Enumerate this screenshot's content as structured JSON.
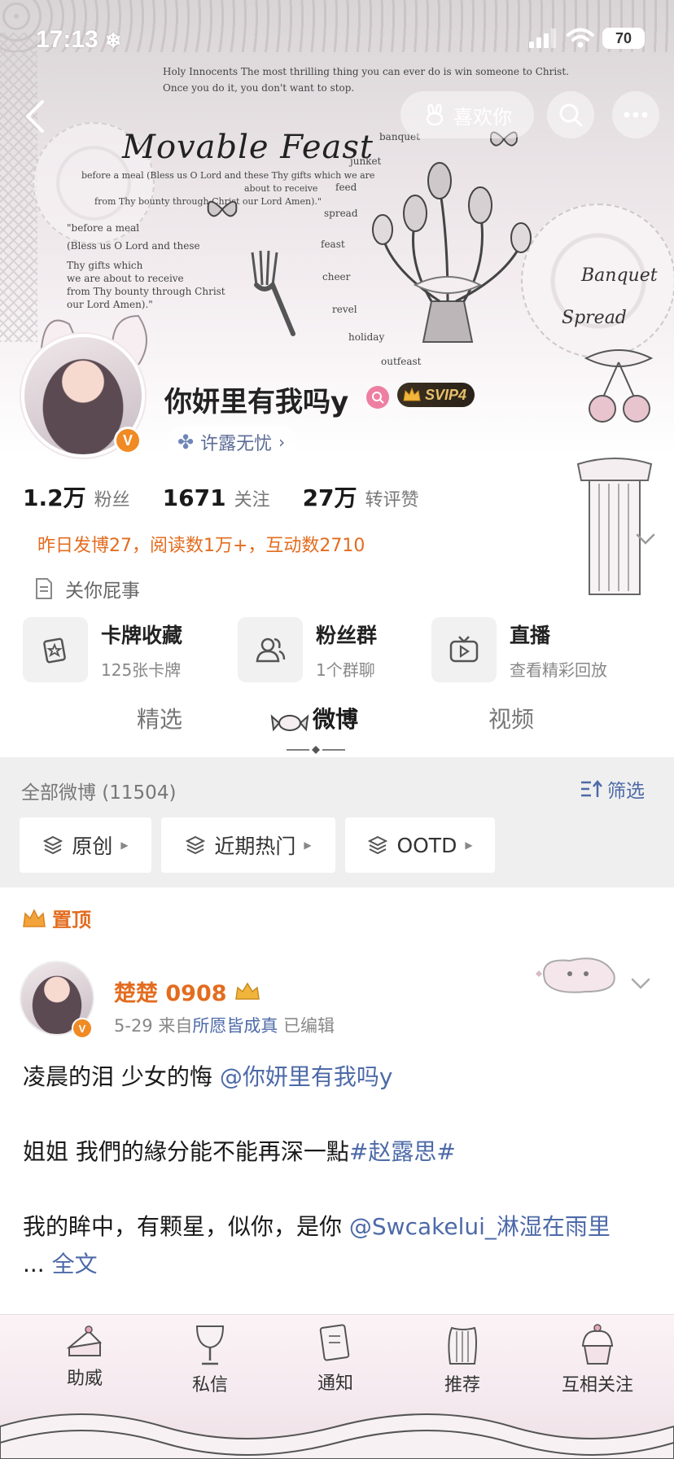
{
  "status_bar": {
    "time": "17:13",
    "battery": "70"
  },
  "banner": {
    "title": "Movable Feast",
    "top_line_1": "Holy Innocents The most thrilling thing you can ever do is win someone to Christ.",
    "top_line_2": "Once you do it, you don't want to stop.",
    "prayer_1": "before a meal (Bless us O Lord and these Thy gifts which we are",
    "prayer_2": "about to receive",
    "prayer_3": "from Thy bounty through Christ our Lord Amen).\"",
    "quote_1": "\"before a meal",
    "quote_2": "(Bless us O Lord and these",
    "quote_3": "Thy gifts which",
    "quote_4": "we are about to receive",
    "quote_5": "from Thy bounty through Christ",
    "quote_6": "our Lord Amen).\"",
    "words": [
      "banquet",
      "junket",
      "feed",
      "spread",
      "feast",
      "cheer",
      "revel",
      "holiday",
      "outfeast"
    ],
    "script_1": "Banquet",
    "script_2": "Spread"
  },
  "actions": {
    "like_label": "喜欢你"
  },
  "profile": {
    "name": "你妍里有我吗y",
    "verified": "V",
    "svip": "SVIP4",
    "tag": "许露无忧",
    "stats": [
      {
        "num": "1.2万",
        "label": "粉丝"
      },
      {
        "num": "1671",
        "label": "关注"
      },
      {
        "num": "27万",
        "label": "转评赞"
      }
    ],
    "activity": "昨日发博27，阅读数1万+，互动数2710",
    "bio": "关你屁事"
  },
  "cards": [
    {
      "title": "卡牌收藏",
      "sub": "125张卡牌"
    },
    {
      "title": "粉丝群",
      "sub": "1个群聊"
    },
    {
      "title": "直播",
      "sub": "查看精彩回放"
    }
  ],
  "tabs": [
    {
      "label": "精选"
    },
    {
      "label": "微博"
    },
    {
      "label": "视频"
    }
  ],
  "filter": {
    "count": "全部微博 (11504)",
    "filter_label": "筛选",
    "chips": [
      "原创",
      "近期热门",
      "OOTD"
    ]
  },
  "post": {
    "pinned_label": "置顶",
    "author": "楚楚 0908",
    "date": "5-29",
    "from_label": "来自",
    "source": "所愿皆成真",
    "edited": "已编辑",
    "line1_text": "凌晨的泪 少女的悔 ",
    "line1_mention": "@你妍里有我吗y",
    "line2_text": "姐姐 我們的緣分能不能再深一點",
    "line2_tag": "#赵露思#",
    "line3_text": "我的眸中，有颗星，似你，是你 ",
    "line3_mention": "@Swcakelui_淋湿在雨里",
    "more_prefix": "... ",
    "more_label": "全文"
  },
  "bottom_nav": [
    {
      "label": "助威",
      "icon": "cake-icon"
    },
    {
      "label": "私信",
      "icon": "goblet-icon"
    },
    {
      "label": "通知",
      "icon": "card-icon"
    },
    {
      "label": "推荐",
      "icon": "harp-icon"
    },
    {
      "label": "互相关注",
      "icon": "cupcake-icon"
    }
  ],
  "colors": {
    "accent_orange": "#e36c1f",
    "link_blue": "#4d6aa8",
    "svip_gold": "#e8c06a"
  }
}
